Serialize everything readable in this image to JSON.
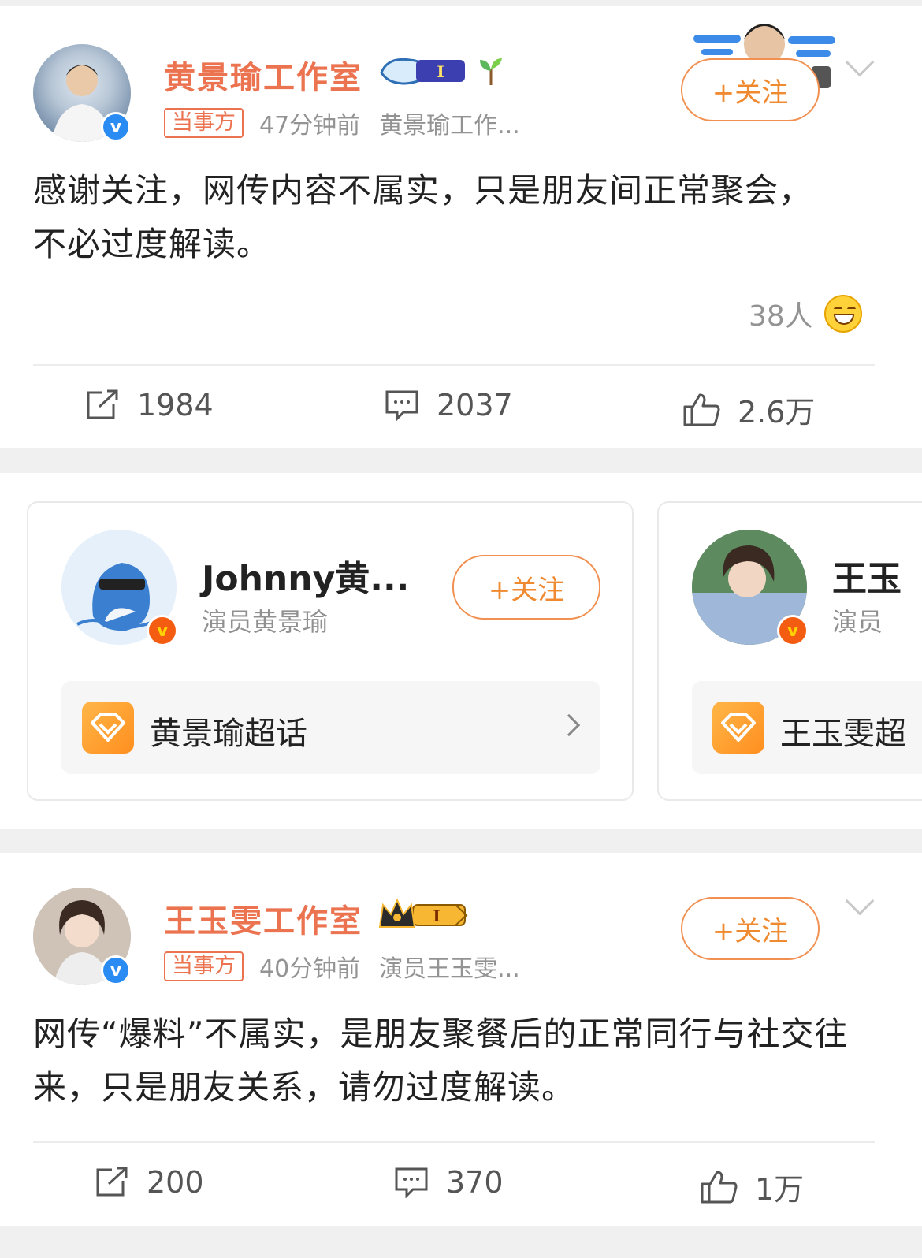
{
  "post1": {
    "author": "黄景瑜工作室",
    "tag": "当事方",
    "time": "47分钟前",
    "source": "黄景瑜工作...",
    "follow_label": "+关注",
    "text": "感谢关注，网传内容不属实，只是朋友间正常聚会，不必过度解读。",
    "reactions": "38人",
    "repost_count": "1984",
    "comment_count": "2037",
    "like_count": "2.6万",
    "level_badge": "I"
  },
  "cards": [
    {
      "name": "Johnny黄...",
      "role": "演员黄景瑜",
      "follow_label": "+关注",
      "topic": "黄景瑜超话"
    },
    {
      "name": "王玉",
      "role": "演员",
      "topic": "王玉雯超"
    }
  ],
  "post2": {
    "author": "王玉雯工作室",
    "tag": "当事方",
    "time": "40分钟前",
    "source": "演员王玉雯...",
    "follow_label": "+关注",
    "text": "网传“爆料”不属实，是朋友聚餐后的正常同行与社交往来，只是朋友关系，请勿过度解读。",
    "repost_count": "200",
    "comment_count": "370",
    "like_count": "1万",
    "level_badge": "I"
  },
  "colors": {
    "name_orange": "#eb7350",
    "follow_orange": "#f08a30",
    "verified_blue": "#2a8bf2",
    "verified_orange": "#f45c12",
    "gap_gray": "#f0f0f0"
  },
  "icons": [
    "verified-icon",
    "whale-badge-icon",
    "sprout-icon",
    "crown-badge-icon",
    "repost-icon",
    "comment-icon",
    "like-icon",
    "smiley-icon",
    "diamond-icon",
    "chevron-right-icon",
    "chevron-down-icon"
  ]
}
